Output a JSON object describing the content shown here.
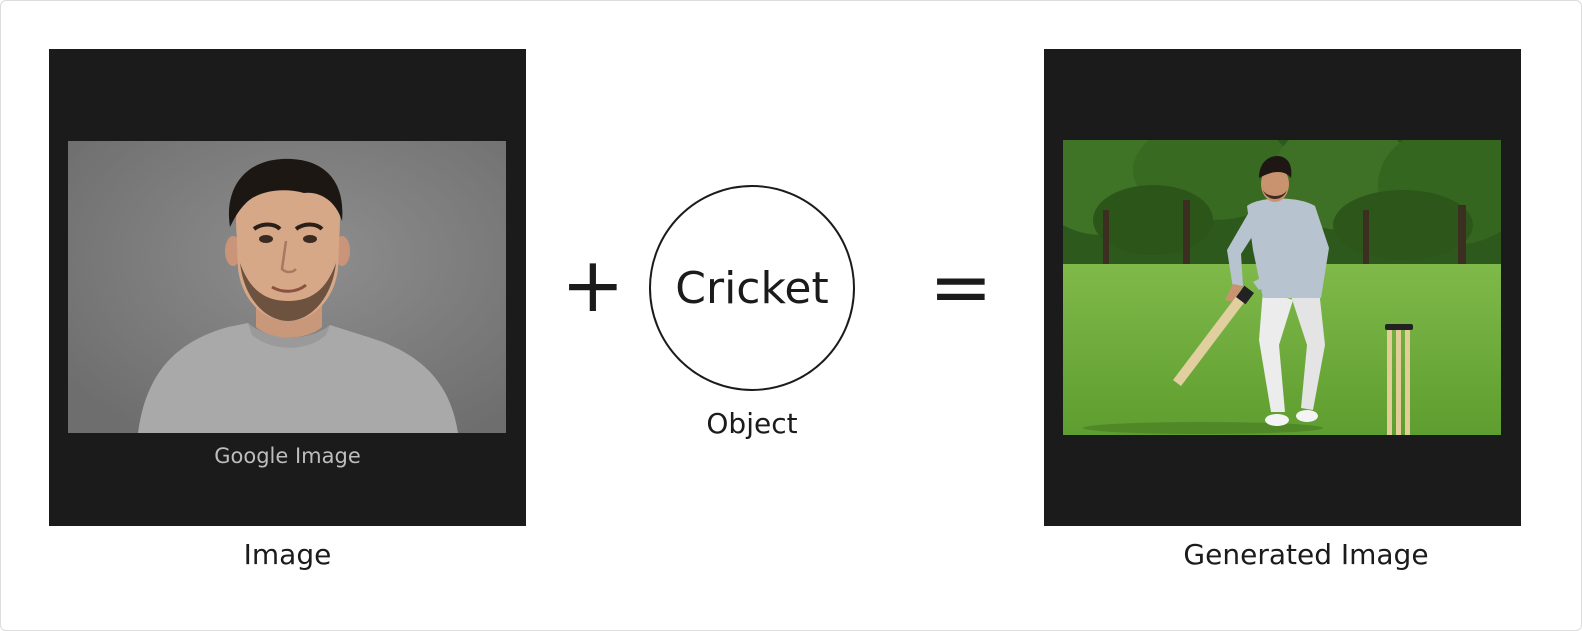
{
  "input": {
    "panel_caption": "Google Image",
    "label": "Image"
  },
  "operators": {
    "plus": "+",
    "equals": "="
  },
  "object": {
    "text": "Cricket",
    "caption": "Object"
  },
  "output": {
    "label": "Generated Image"
  },
  "colors": {
    "panel_background": "#1b1b1b",
    "text": "#1b1b1b",
    "panel_caption": "#bdbdbd",
    "grass": "#6fae3a",
    "trees": "#2f5a1e"
  }
}
